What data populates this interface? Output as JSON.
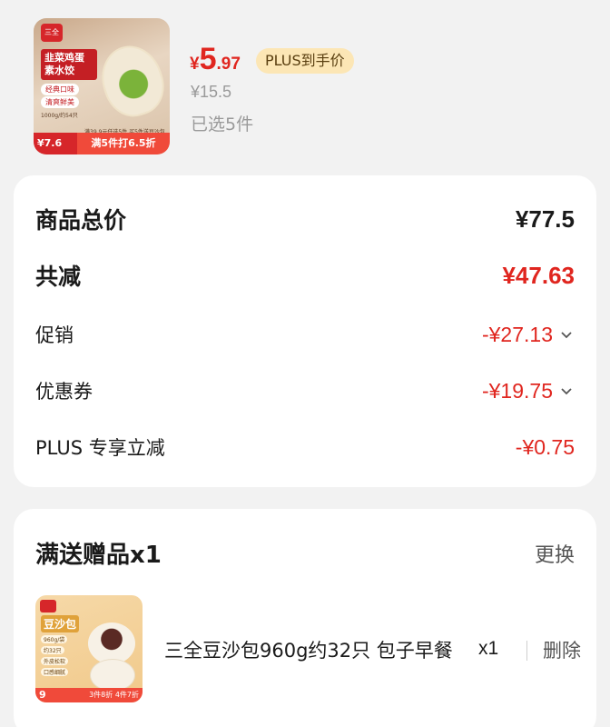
{
  "product": {
    "image": {
      "logo": "三全",
      "title": "韭菜鸡蛋素水饺",
      "tag1": "经典口味",
      "tag2": "清爽鲜美",
      "weight": "1000g/约54只",
      "promo": "满39.9元任选5件 买5件送豆沙包",
      "price": "¥7.6",
      "deal": "满5件打6.5折"
    },
    "price_symbol": "¥",
    "price_int": "5",
    "price_dec": ".97",
    "plus_badge": "PLUS到手价",
    "original_price": "¥15.5",
    "selected_count": "已选5件"
  },
  "summary": {
    "total_label": "商品总价",
    "total_value": "¥77.5",
    "reduce_label": "共减",
    "reduce_value": "¥47.63",
    "promo_label": "促销",
    "promo_value": "-¥27.13",
    "coupon_label": "优惠券",
    "coupon_value": "-¥19.75",
    "plus_label": "PLUS 专享立减",
    "plus_value": "-¥0.75"
  },
  "gift": {
    "title": "满送赠品x1",
    "change_label": "更换",
    "image": {
      "title": "豆沙包",
      "tag1": "960g/袋",
      "tag2": "约32只",
      "tag3": "外皮松软",
      "tag4": "口感细腻",
      "number": "9",
      "foot": "3件8折 4件7折"
    },
    "name": "三全豆沙包960g约32只 包子早餐",
    "qty": "x1",
    "delete_label": "删除"
  },
  "colors": {
    "accent_red": "#e0261f",
    "plus_gold": "#fce6b5",
    "background": "#f2f2f2"
  }
}
